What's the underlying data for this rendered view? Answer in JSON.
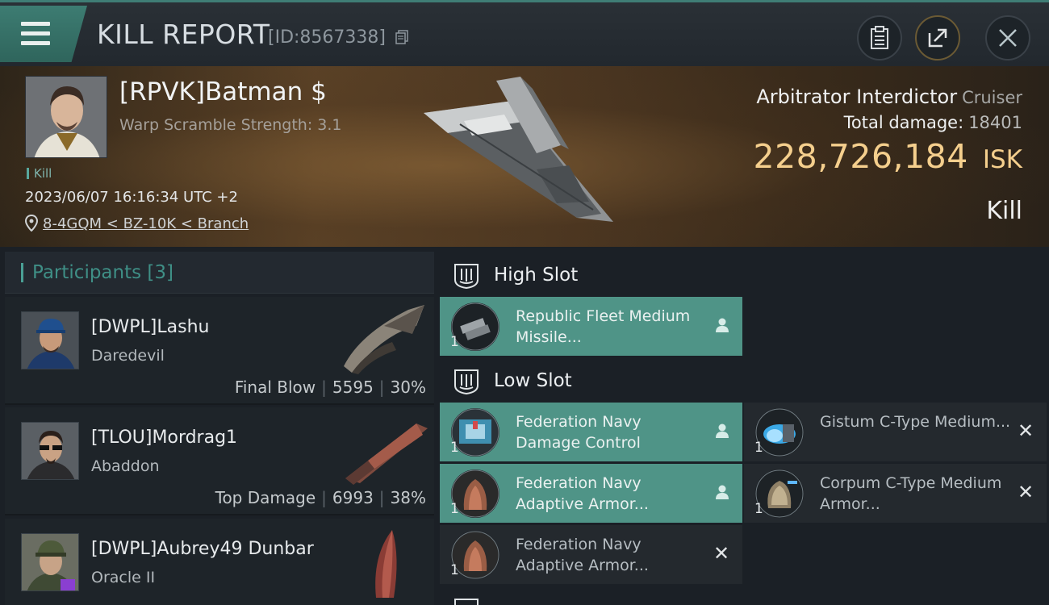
{
  "header": {
    "title": "KILL REPORT",
    "report_id": "[ID:8567338]"
  },
  "victim": {
    "name": "[RPVK]Batman $",
    "warp_scramble": "Warp Scramble Strength: 3.1",
    "kill_tag": "Kill",
    "datetime": "2023/06/07 16:16:34 UTC +2",
    "location": "8-4GQM < BZ-10K < Branch",
    "ship_name": "Arbitrator Interdictor",
    "ship_class": "Cruiser",
    "total_damage_label": "Total damage:",
    "total_damage": "18401",
    "isk_value": "228,726,184",
    "isk_unit": "ISK",
    "result": "Kill"
  },
  "participants": {
    "label": "Participants [3]",
    "items": [
      {
        "name": "[DWPL]Lashu",
        "ship": "Daredevil",
        "role": "Final Blow",
        "damage": "5595",
        "percent": "30%"
      },
      {
        "name": "[TLOU]Mordrag1",
        "ship": "Abaddon",
        "role": "Top Damage",
        "damage": "6993",
        "percent": "38%"
      },
      {
        "name": "[DWPL]Aubrey49 Dunbar",
        "ship": "Oracle II",
        "role": "",
        "damage": "",
        "percent": ""
      }
    ]
  },
  "slots": {
    "high": {
      "label": "High Slot",
      "modules": [
        {
          "name": "Republic Fleet Medium Missile...",
          "qty": "1",
          "status": "dropped"
        }
      ]
    },
    "low": {
      "label": "Low Slot",
      "modules": [
        {
          "name": "Federation Navy Damage Control",
          "qty": "1",
          "status": "dropped"
        },
        {
          "name": "Gistum C-Type Medium...",
          "qty": "1",
          "status": "destroyed"
        },
        {
          "name": "Federation Navy Adaptive Armor...",
          "qty": "1",
          "status": "dropped"
        },
        {
          "name": "Corpum C-Type Medium Armor...",
          "qty": "1",
          "status": "destroyed"
        },
        {
          "name": "Federation Navy Adaptive Armor...",
          "qty": "1",
          "status": "destroyed"
        }
      ]
    }
  },
  "colors": {
    "accent_teal": "#4f9487",
    "isk_gold": "#f5cf8d"
  }
}
